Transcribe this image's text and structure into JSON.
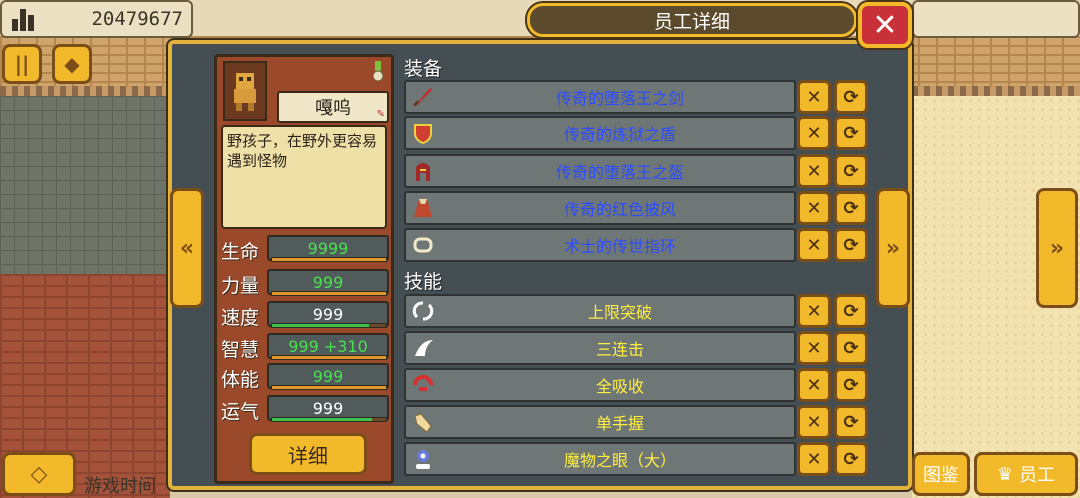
{
  "hud": {
    "money": "20479677",
    "game_time_label": "游戏时间"
  },
  "window": {
    "title": "员工详细",
    "close_symbol": "✕"
  },
  "character": {
    "name": "嘎呜",
    "description": "野孩子，在野外更容易遇到怪物",
    "stats": [
      {
        "label": "生命",
        "value": "9999",
        "value_color": "green",
        "bar": 1.0,
        "bar_color": "orange"
      },
      {
        "label": "力量",
        "value": "999",
        "value_color": "green",
        "bar": 1.0,
        "bar_color": "orange"
      },
      {
        "label": "速度",
        "value": "999",
        "value_color": "white",
        "bar": 0.85,
        "bar_color": "green"
      },
      {
        "label": "智慧",
        "value": "999 +310",
        "value_color": "green",
        "bar": 1.0,
        "bar_color": "orange"
      },
      {
        "label": "体能",
        "value": "999",
        "value_color": "green",
        "bar": 1.0,
        "bar_color": "orange"
      },
      {
        "label": "运气",
        "value": "999",
        "value_color": "white",
        "bar": 0.88,
        "bar_color": "green"
      }
    ],
    "detail_button": "详细"
  },
  "equipment": {
    "title": "装备",
    "items": [
      {
        "name": "传奇的堕落王之剑",
        "icon": "sword-icon"
      },
      {
        "name": "传奇的炼狱之盾",
        "icon": "shield-icon"
      },
      {
        "name": "传奇的堕落王之盔",
        "icon": "helmet-icon"
      },
      {
        "name": "传奇的红色披风",
        "icon": "cape-icon"
      },
      {
        "name": "术士的传世指环",
        "icon": "ring-icon"
      }
    ]
  },
  "skills": {
    "title": "技能",
    "items": [
      {
        "name": "上限突破",
        "icon": "limit-break-icon"
      },
      {
        "name": "三连击",
        "icon": "triple-strike-icon"
      },
      {
        "name": "全吸收",
        "icon": "absorb-icon"
      },
      {
        "name": "单手握",
        "icon": "one-hand-icon"
      },
      {
        "name": "魔物之眼（大）",
        "icon": "monster-eye-icon"
      }
    ]
  },
  "bottom_nav": {
    "encyclopedia_label": "图鉴",
    "staff_label": "员工"
  },
  "colors": {
    "gold": "#f2b92a",
    "panel": "#454e52",
    "equip_text": "#2b4cff",
    "skill_text": "#ffee40",
    "stat_green": "#48e050"
  }
}
